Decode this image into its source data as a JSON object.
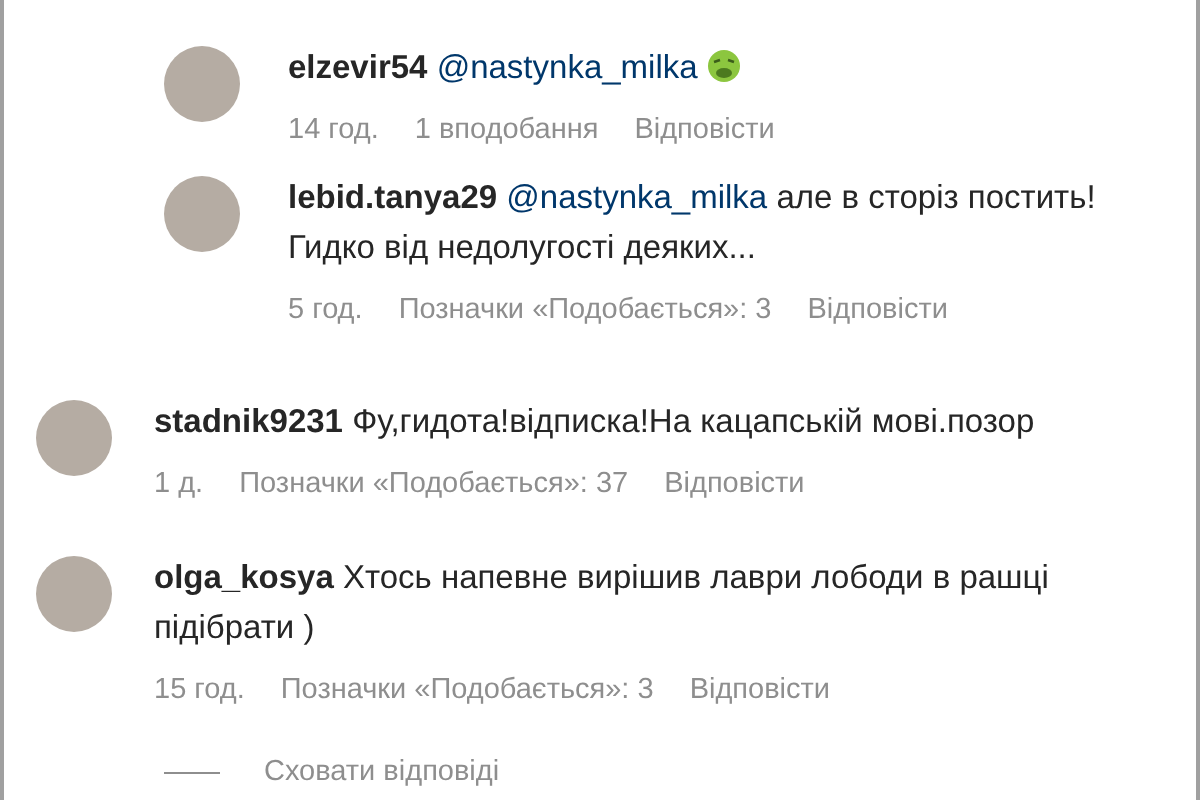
{
  "replies": [
    {
      "username": "elzevir54",
      "mention": "@nastynka_milka",
      "emoji": true,
      "time": "14 год.",
      "likes": "1 вподобання",
      "reply": "Відповісти"
    },
    {
      "username": "lebid.tanya29",
      "mention": "@nastynka_milka",
      "text": "але в сторіз постить!Гидко від недолугості деяких...",
      "emoji": false,
      "time": "5 год.",
      "likes": "Позначки «Подобається»: 3",
      "reply": "Відповісти"
    }
  ],
  "comments": [
    {
      "username": "stadnik9231",
      "text": "Фу,гидота!відписка!На кацапській мові.позор",
      "time": "1 д.",
      "likes": "Позначки «Подобається»: 37",
      "reply": "Відповісти"
    },
    {
      "username": "olga_kosya",
      "text": "Хтось напевне вирішив лаври лободи в рашці підібрати )",
      "time": "15 год.",
      "likes": "Позначки «Подобається»: 3",
      "reply": "Відповісти"
    }
  ],
  "hide_replies": "Сховати відповіді"
}
